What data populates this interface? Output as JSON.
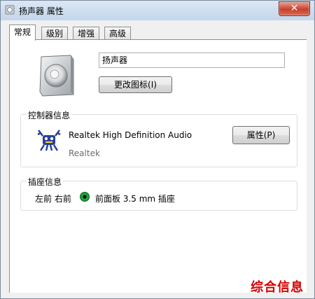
{
  "window": {
    "title": "扬声器 属性",
    "close_label": "✕"
  },
  "tabs": [
    {
      "label": "常规",
      "active": true
    },
    {
      "label": "级别",
      "active": false
    },
    {
      "label": "增强",
      "active": false
    },
    {
      "label": "高级",
      "active": false
    }
  ],
  "general": {
    "device_name": "扬声器",
    "change_icon_label": "更改图标(I)"
  },
  "controller": {
    "group_title": "控制器信息",
    "name": "Realtek High Definition Audio",
    "vendor": "Realtek",
    "properties_label": "属性(P)"
  },
  "jack": {
    "group_title": "插座信息",
    "location": "左前 右前",
    "description": "前面板 3.5 mm 插座",
    "jack_color": "#1fa33a"
  },
  "watermark": "综合信息"
}
